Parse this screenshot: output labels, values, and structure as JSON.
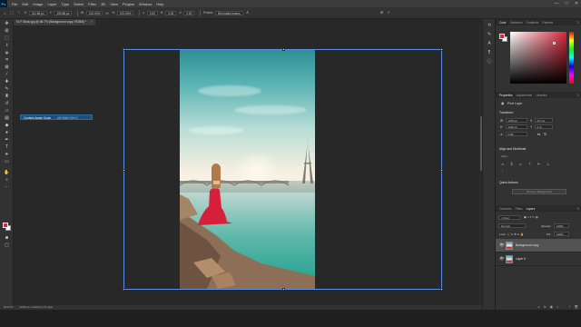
{
  "menubar": {
    "logo": "Ps",
    "items": [
      "File",
      "Edit",
      "Image",
      "Layer",
      "Type",
      "Select",
      "Filter",
      "3D",
      "View",
      "Plugins",
      "Window",
      "Help"
    ],
    "window_controls": [
      "—",
      "□",
      "✕"
    ]
  },
  "options_bar": {
    "ref_point_label": "X:",
    "x_value": "311.85 px",
    "y_label": "Y:",
    "y_value": "195.85 px",
    "w_label": "W:",
    "w_value": "100.00%",
    "h_label": "H:",
    "h_value": "100.00%",
    "angle_label": "∠",
    "angle_value": "0.00",
    "h_skew_label": "H:",
    "h_skew_value": "0.00",
    "v_skew_label": "V:",
    "v_skew_value": "0.00",
    "interp_label": "Interpolation:",
    "interp_value": "Bicubic",
    "protect_label": "Protect:",
    "protect_value": "Bird walks leaves",
    "cancel_icon": "⊘",
    "commit_icon": "✓"
  },
  "document_tab": {
    "title": "VLF Stock.jpg @ 66.7% (Background copy, RGB/8) *",
    "close": "×"
  },
  "tooltip": {
    "label": "Content-Aware Scale",
    "shortcut": "Alt+Shift+Ctrl+C"
  },
  "statusbar": {
    "zoom": "66.67%",
    "dims": "1078 px x 1920 px (72 ppi)"
  },
  "color_panel": {
    "tabs": [
      "Color",
      "Swatches",
      "Gradients",
      "Patterns"
    ],
    "fg_color": "#d52a3a",
    "bg_color": "#ffffff"
  },
  "properties_panel": {
    "tabs": [
      "Properties",
      "Adjustments",
      "Libraries"
    ],
    "layer_kind": "Pixel Layer",
    "transform_title": "Transform",
    "w_value": "1078 px",
    "h_value": "1920 px",
    "x_value": "277 px",
    "y_value": "0 px",
    "angle_value": "0.00°",
    "align_title": "Align and Distribute",
    "align_sub": "Align:",
    "quick_actions_title": "Quick Actions",
    "quick_action_btn": "Remove Background"
  },
  "layers_panel": {
    "tabs": [
      "Channels",
      "Paths",
      "Layers"
    ],
    "kind_label": "Kind",
    "blend_mode": "Normal",
    "opacity_label": "Opacity:",
    "opacity_value": "100%",
    "lock_label": "Lock:",
    "fill_label": "Fill:",
    "fill_value": "100%",
    "layers": [
      {
        "name": "Background copy",
        "selected": true
      },
      {
        "name": "Layer 0",
        "selected": false
      }
    ],
    "footer_icons": [
      "fx",
      "◑",
      "▣",
      "🗀",
      "+",
      "🗑"
    ]
  },
  "toolbar": {
    "tools": [
      "move-tool",
      "artboard-tool",
      "marquee-tool",
      "lasso-tool",
      "object-select-tool",
      "crop-tool",
      "frame-tool",
      "eyedropper-tool",
      "healing-tool",
      "brush-tool",
      "clone-stamp-tool",
      "history-brush-tool",
      "eraser-tool",
      "gradient-tool",
      "blur-tool",
      "dodge-tool",
      "pen-tool",
      "type-tool",
      "path-select-tool",
      "shape-tool",
      "hand-tool",
      "zoom-tool",
      "more-tools"
    ]
  }
}
